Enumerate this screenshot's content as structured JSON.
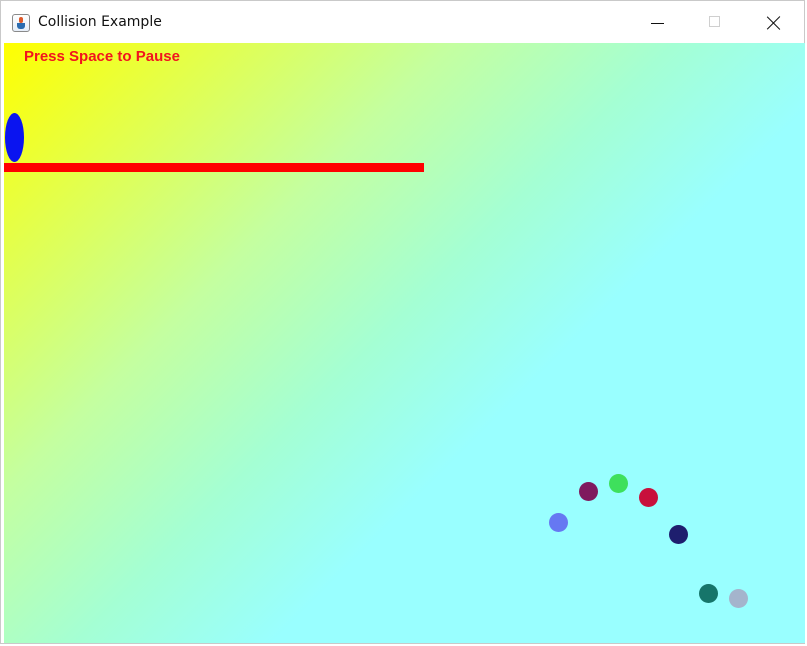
{
  "window": {
    "title": "Collision Example",
    "controls": {
      "minimize": "minimize-icon",
      "maximize": "maximize-icon",
      "close": "close-icon"
    }
  },
  "game": {
    "hud_text": "Press Space to Pause",
    "colors": {
      "hud_text": "#f2141e",
      "paddle": "#ff0000",
      "oval": "#0a14f0",
      "background_start": "#ffff00",
      "background_end": "#99ffff"
    },
    "balls": [
      {
        "id": "ball-1",
        "color": "#7f1a5e"
      },
      {
        "id": "ball-2",
        "color": "#3ee05c"
      },
      {
        "id": "ball-3",
        "color": "#c8103c"
      },
      {
        "id": "ball-4",
        "color": "#6678f2"
      },
      {
        "id": "ball-5",
        "color": "#1e1e6e"
      },
      {
        "id": "ball-6",
        "color": "#16756a"
      },
      {
        "id": "ball-7",
        "color": "#a4b4cc"
      }
    ]
  }
}
